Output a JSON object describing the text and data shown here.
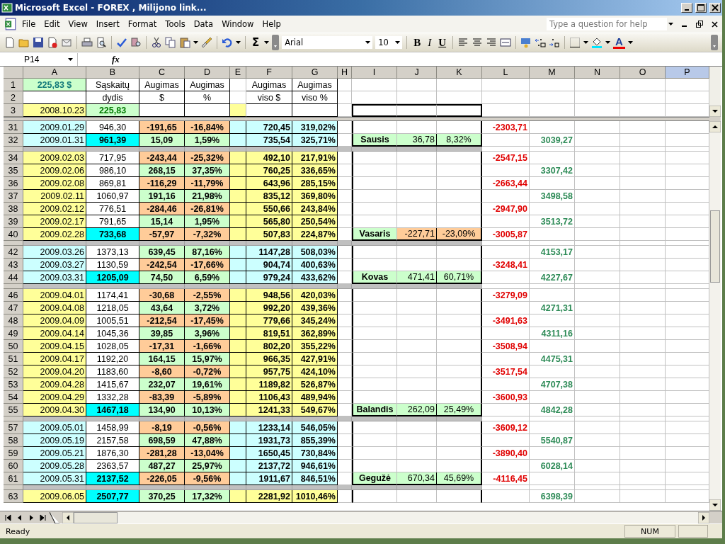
{
  "window": {
    "title": "Microsoft Excel - FOREX , Milijono link..."
  },
  "menu": [
    "File",
    "Edit",
    "View",
    "Insert",
    "Format",
    "Tools",
    "Data",
    "Window",
    "Help"
  ],
  "help_box": {
    "placeholder": "Type a question for help"
  },
  "toolbar": {
    "sum": "Σ",
    "font": "Arial",
    "size": "10",
    "format_buttons": [
      "B",
      "I",
      "U"
    ],
    "font_color": "A"
  },
  "formula_bar": {
    "name_box": "P14",
    "fx": "fx"
  },
  "columns": [
    {
      "label": "A",
      "selected": false
    },
    {
      "label": "B",
      "selected": false
    },
    {
      "label": "C",
      "selected": false
    },
    {
      "label": "D",
      "selected": false
    },
    {
      "label": "E",
      "selected": false
    },
    {
      "label": "F",
      "selected": false
    },
    {
      "label": "G",
      "selected": false
    },
    {
      "label": "H",
      "selected": false
    },
    {
      "label": "I",
      "selected": false
    },
    {
      "label": "J",
      "selected": false
    },
    {
      "label": "K",
      "selected": false
    },
    {
      "label": "L",
      "selected": false
    },
    {
      "label": "M",
      "selected": false
    },
    {
      "label": "N",
      "selected": false
    },
    {
      "label": "O",
      "selected": false
    },
    {
      "label": "P",
      "selected": true
    }
  ],
  "top_rows": [
    {
      "n": "1",
      "kind": "title",
      "total": "225,83 $",
      "labels": [
        "Sąskaitų",
        "Augimas",
        "Augimas",
        "Augimas",
        "Augimas"
      ]
    },
    {
      "n": "2",
      "kind": "title",
      "labels": [
        "dydis",
        "$",
        "%",
        "viso $",
        "viso %"
      ]
    },
    {
      "n": "3",
      "kind": "start",
      "date": "2008.10.23",
      "size": "225,83"
    }
  ],
  "rows": [
    {
      "kind": "data",
      "n": "31",
      "color": "#ccffff",
      "date": "2009.01.29",
      "size": "946,30",
      "highlighted": false,
      "change": "-191,65",
      "change_pct": "-16,84%",
      "gain": false,
      "total": "720,45",
      "total_pct": "319,02%",
      "low": "-2303,71"
    },
    {
      "kind": "data",
      "n": "32",
      "color": "#ccffff",
      "date": "2009.01.31",
      "size": "961,39",
      "highlighted": true,
      "change": "15,09",
      "change_pct": "1,59%",
      "gain": true,
      "total": "735,54",
      "total_pct": "325,71%",
      "summary": {
        "label": "Sausis",
        "change": "36,78",
        "pct": "8,32%",
        "gain": true
      },
      "high": "3039,27"
    },
    {
      "kind": "gap"
    },
    {
      "kind": "data",
      "n": "34",
      "color": "#ffff99",
      "date": "2009.02.03",
      "size": "717,95",
      "highlighted": false,
      "change": "-243,44",
      "change_pct": "-25,32%",
      "gain": false,
      "total": "492,10",
      "total_pct": "217,91%",
      "low": "-2547,15"
    },
    {
      "kind": "data",
      "n": "35",
      "color": "#ffff99",
      "date": "2009.02.06",
      "size": "986,10",
      "highlighted": false,
      "change": "268,15",
      "change_pct": "37,35%",
      "gain": true,
      "total": "760,25",
      "total_pct": "336,65%",
      "high": "3307,42"
    },
    {
      "kind": "data",
      "n": "36",
      "color": "#ffff99",
      "date": "2009.02.08",
      "size": "869,81",
      "highlighted": false,
      "change": "-116,29",
      "change_pct": "-11,79%",
      "gain": false,
      "total": "643,96",
      "total_pct": "285,15%",
      "low": "-2663,44"
    },
    {
      "kind": "data",
      "n": "37",
      "color": "#ffff99",
      "date": "2009.02.11",
      "size": "1060,97",
      "highlighted": false,
      "change": "191,16",
      "change_pct": "21,98%",
      "gain": true,
      "total": "835,12",
      "total_pct": "369,80%",
      "high": "3498,58"
    },
    {
      "kind": "data",
      "n": "38",
      "color": "#ffff99",
      "date": "2009.02.12",
      "size": "776,51",
      "highlighted": false,
      "change": "-284,46",
      "change_pct": "-26,81%",
      "gain": false,
      "total": "550,66",
      "total_pct": "243,84%",
      "low": "-2947,90"
    },
    {
      "kind": "data",
      "n": "39",
      "color": "#ffff99",
      "date": "2009.02.17",
      "size": "791,65",
      "highlighted": false,
      "change": "15,14",
      "change_pct": "1,95%",
      "gain": true,
      "total": "565,80",
      "total_pct": "250,54%",
      "high": "3513,72"
    },
    {
      "kind": "data",
      "n": "40",
      "color": "#ffff99",
      "date": "2009.02.28",
      "size": "733,68",
      "highlighted": true,
      "change": "-57,97",
      "change_pct": "-7,32%",
      "gain": false,
      "total": "507,83",
      "total_pct": "224,87%",
      "summary": {
        "label": "Vasaris",
        "change": "-227,71",
        "pct": "-23,09%",
        "gain": false
      },
      "low": "-3005,87"
    },
    {
      "kind": "gap"
    },
    {
      "kind": "data",
      "n": "42",
      "color": "#ccffff",
      "date": "2009.03.26",
      "size": "1373,13",
      "highlighted": false,
      "change": "639,45",
      "change_pct": "87,16%",
      "gain": true,
      "total": "1147,28",
      "total_pct": "508,03%",
      "high": "4153,17"
    },
    {
      "kind": "data",
      "n": "43",
      "color": "#ccffff",
      "date": "2009.03.27",
      "size": "1130,59",
      "highlighted": false,
      "change": "-242,54",
      "change_pct": "-17,66%",
      "gain": false,
      "total": "904,74",
      "total_pct": "400,63%",
      "low": "-3248,41"
    },
    {
      "kind": "data",
      "n": "44",
      "color": "#ccffff",
      "date": "2009.03.31",
      "size": "1205,09",
      "highlighted": true,
      "change": "74,50",
      "change_pct": "6,59%",
      "gain": true,
      "total": "979,24",
      "total_pct": "433,62%",
      "summary": {
        "label": "Kovas",
        "change": "471,41",
        "pct": "60,71%",
        "gain": true
      },
      "high": "4227,67"
    },
    {
      "kind": "gap"
    },
    {
      "kind": "data",
      "n": "46",
      "color": "#ffff99",
      "date": "2009.04.01",
      "size": "1174,41",
      "highlighted": false,
      "change": "-30,68",
      "change_pct": "-2,55%",
      "gain": false,
      "total": "948,56",
      "total_pct": "420,03%",
      "low": "-3279,09"
    },
    {
      "kind": "data",
      "n": "47",
      "color": "#ffff99",
      "date": "2009.04.08",
      "size": "1218,05",
      "highlighted": false,
      "change": "43,64",
      "change_pct": "3,72%",
      "gain": true,
      "total": "992,20",
      "total_pct": "439,36%",
      "high": "4271,31"
    },
    {
      "kind": "data",
      "n": "48",
      "color": "#ffff99",
      "date": "2009.04.09",
      "size": "1005,51",
      "highlighted": false,
      "change": "-212,54",
      "change_pct": "-17,45%",
      "gain": false,
      "total": "779,66",
      "total_pct": "345,24%",
      "low": "-3491,63"
    },
    {
      "kind": "data",
      "n": "49",
      "color": "#ffff99",
      "date": "2009.04.14",
      "size": "1045,36",
      "highlighted": false,
      "change": "39,85",
      "change_pct": "3,96%",
      "gain": true,
      "total": "819,51",
      "total_pct": "362,89%",
      "high": "4311,16"
    },
    {
      "kind": "data",
      "n": "50",
      "color": "#ffff99",
      "date": "2009.04.15",
      "size": "1028,05",
      "highlighted": false,
      "change": "-17,31",
      "change_pct": "-1,66%",
      "gain": false,
      "total": "802,20",
      "total_pct": "355,22%",
      "low": "-3508,94"
    },
    {
      "kind": "data",
      "n": "51",
      "color": "#ffff99",
      "date": "2009.04.17",
      "size": "1192,20",
      "highlighted": false,
      "change": "164,15",
      "change_pct": "15,97%",
      "gain": true,
      "total": "966,35",
      "total_pct": "427,91%",
      "high": "4475,31"
    },
    {
      "kind": "data",
      "n": "52",
      "color": "#ffff99",
      "date": "2009.04.20",
      "size": "1183,60",
      "highlighted": false,
      "change": "-8,60",
      "change_pct": "-0,72%",
      "gain": false,
      "total": "957,75",
      "total_pct": "424,10%",
      "low": "-3517,54"
    },
    {
      "kind": "data",
      "n": "53",
      "color": "#ffff99",
      "date": "2009.04.28",
      "size": "1415,67",
      "highlighted": false,
      "change": "232,07",
      "change_pct": "19,61%",
      "gain": true,
      "total": "1189,82",
      "total_pct": "526,87%",
      "high": "4707,38"
    },
    {
      "kind": "data",
      "n": "54",
      "color": "#ffff99",
      "date": "2009.04.29",
      "size": "1332,28",
      "highlighted": false,
      "change": "-83,39",
      "change_pct": "-5,89%",
      "gain": false,
      "total": "1106,43",
      "total_pct": "489,94%",
      "low": "-3600,93"
    },
    {
      "kind": "data",
      "n": "55",
      "color": "#ffff99",
      "date": "2009.04.30",
      "size": "1467,18",
      "highlighted": true,
      "change": "134,90",
      "change_pct": "10,13%",
      "gain": true,
      "total": "1241,33",
      "total_pct": "549,67%",
      "summary": {
        "label": "Balandis",
        "change": "262,09",
        "pct": "25,49%",
        "gain": true
      },
      "high": "4842,28"
    },
    {
      "kind": "gap"
    },
    {
      "kind": "data",
      "n": "57",
      "color": "#ccffff",
      "date": "2009.05.01",
      "size": "1458,99",
      "highlighted": false,
      "change": "-8,19",
      "change_pct": "-0,56%",
      "gain": false,
      "total": "1233,14",
      "total_pct": "546,05%",
      "low": "-3609,12"
    },
    {
      "kind": "data",
      "n": "58",
      "color": "#ccffff",
      "date": "2009.05.19",
      "size": "2157,58",
      "highlighted": false,
      "change": "698,59",
      "change_pct": "47,88%",
      "gain": true,
      "total": "1931,73",
      "total_pct": "855,39%",
      "high": "5540,87"
    },
    {
      "kind": "data",
      "n": "59",
      "color": "#ccffff",
      "date": "2009.05.21",
      "size": "1876,30",
      "highlighted": false,
      "change": "-281,28",
      "change_pct": "-13,04%",
      "gain": false,
      "total": "1650,45",
      "total_pct": "730,84%",
      "low": "-3890,40"
    },
    {
      "kind": "data",
      "n": "60",
      "color": "#ccffff",
      "date": "2009.05.28",
      "size": "2363,57",
      "highlighted": false,
      "change": "487,27",
      "change_pct": "25,97%",
      "gain": true,
      "total": "2137,72",
      "total_pct": "946,61%",
      "high": "6028,14"
    },
    {
      "kind": "data",
      "n": "61",
      "color": "#ccffff",
      "date": "2009.05.31",
      "size": "2137,52",
      "highlighted": true,
      "change": "-226,05",
      "change_pct": "-9,56%",
      "gain": false,
      "total": "1911,67",
      "total_pct": "846,51%",
      "summary": {
        "label": "Gegužė",
        "change": "670,34",
        "pct": "45,69%",
        "gain": true
      },
      "low": "-4116,45"
    },
    {
      "kind": "gap"
    },
    {
      "kind": "data",
      "n": "63",
      "color": "#ffff99",
      "date": "2009.06.05",
      "size": "2507,77",
      "highlighted": true,
      "change": "370,25",
      "change_pct": "17,32%",
      "gain": true,
      "total": "2281,92",
      "total_pct": "1010,46%",
      "high": "6398,39"
    }
  ],
  "status_bar": {
    "text": "Ready",
    "num": "NUM"
  }
}
